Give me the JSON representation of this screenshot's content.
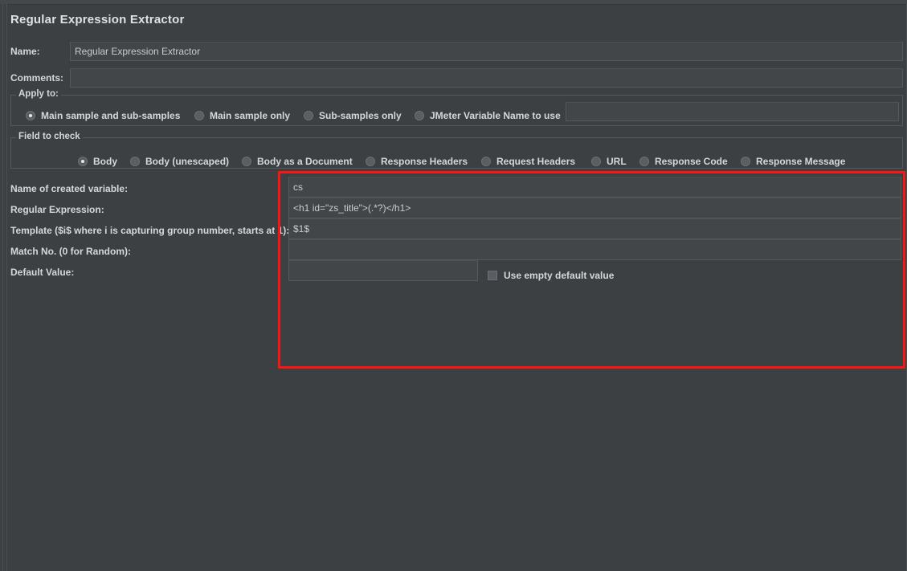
{
  "window": {
    "title": "Regular Expression Extractor"
  },
  "form": {
    "name_label": "Name:",
    "name_value": "Regular Expression Extractor",
    "comments_label": "Comments:",
    "comments_value": ""
  },
  "apply_to": {
    "legend": "Apply to:",
    "options": [
      {
        "label": "Main sample and sub-samples",
        "selected": true
      },
      {
        "label": "Main sample only",
        "selected": false
      },
      {
        "label": "Sub-samples only",
        "selected": false
      },
      {
        "label": "JMeter Variable Name to use",
        "selected": false
      }
    ],
    "variable_name_value": ""
  },
  "field_to_check": {
    "legend": "Field to check",
    "options": [
      {
        "label": "Body",
        "selected": true
      },
      {
        "label": "Body (unescaped)",
        "selected": false
      },
      {
        "label": "Body as a Document",
        "selected": false
      },
      {
        "label": "Response Headers",
        "selected": false
      },
      {
        "label": "Request Headers",
        "selected": false
      },
      {
        "label": "URL",
        "selected": false
      },
      {
        "label": "Response Code",
        "selected": false
      },
      {
        "label": "Response Message",
        "selected": false
      }
    ]
  },
  "extractor": {
    "variable_name_label": "Name of created variable:",
    "variable_name_value": "cs",
    "regex_label": "Regular Expression:",
    "regex_value": "<h1 id=\"zs_title\">(.*?)</h1>",
    "template_label": "Template ($i$ where i is capturing group number, starts at 1):",
    "template_value": "$1$",
    "match_no_label": "Match No. (0 for Random):",
    "match_no_value": "",
    "default_value_label": "Default Value:",
    "default_value_value": "",
    "use_empty_default_label": "Use empty default value",
    "use_empty_default_checked": false
  },
  "annotation": {
    "highlight_color": "#fb1411"
  }
}
